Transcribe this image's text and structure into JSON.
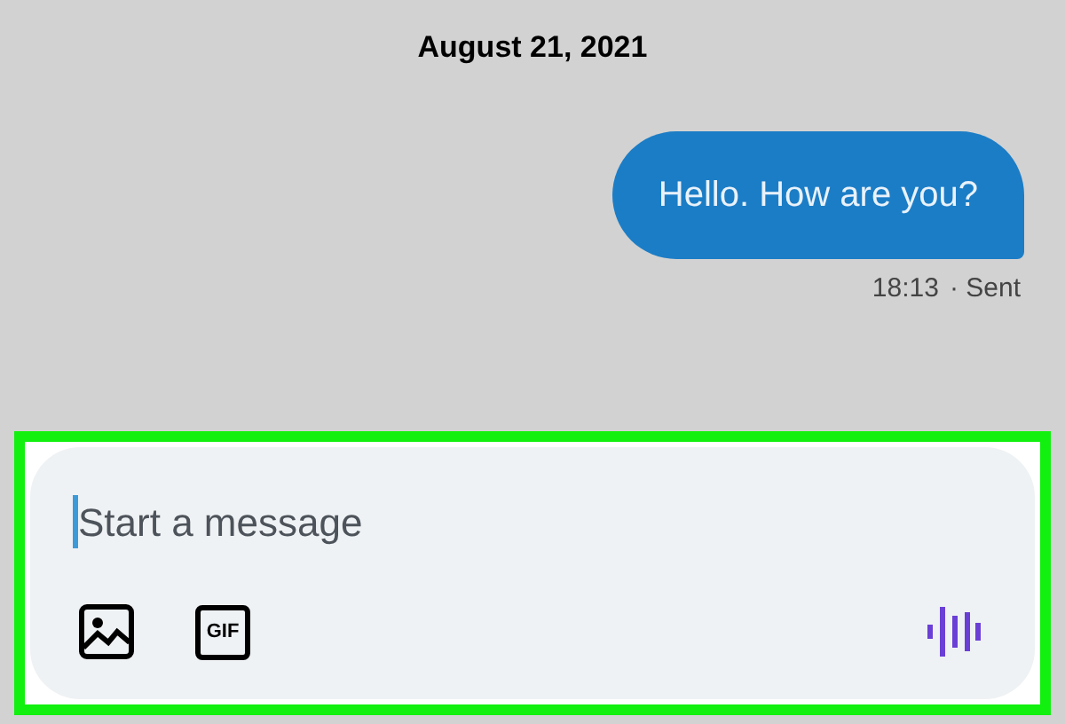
{
  "date_header": "August 21, 2021",
  "messages": [
    {
      "text": "Hello. How are you?",
      "time": "18:13",
      "status": "· Sent"
    }
  ],
  "composer": {
    "placeholder": "Start a message",
    "gif_label": "GIF",
    "highlighted": true
  }
}
